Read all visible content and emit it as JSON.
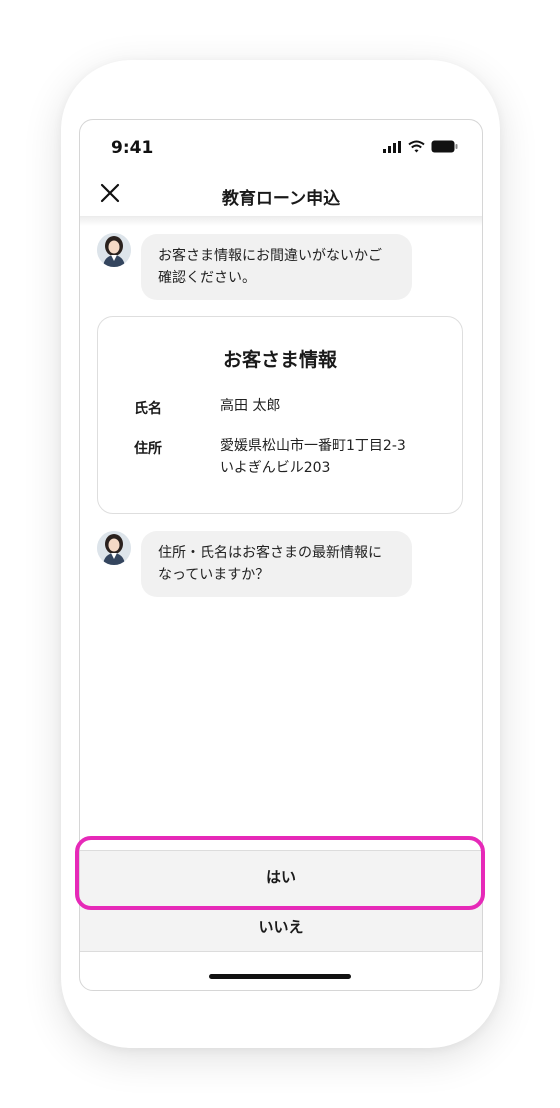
{
  "status_bar": {
    "time": "9:41"
  },
  "header": {
    "title": "教育ローン申込"
  },
  "chat": {
    "message_1_line_1": "お客さま情報にお間違いがないかご",
    "message_1_line_2": "確認ください。",
    "message_2_line_1": "住所・氏名はお客さまの最新情報に",
    "message_2_line_2": "なっていますか？"
  },
  "card": {
    "title": "お客さま情報",
    "name_label": "氏名",
    "name_value": "高田 太郎",
    "address_label": "住所",
    "address_line_1": "愛媛県松山市一番町1丁目2-3",
    "address_line_2": "いよぎんビル203"
  },
  "answers": {
    "yes": "はい",
    "no": "いいえ"
  },
  "colors": {
    "highlight": "#e629b8",
    "bubble": "#f1f1f1",
    "button": "#f3f3f3"
  }
}
